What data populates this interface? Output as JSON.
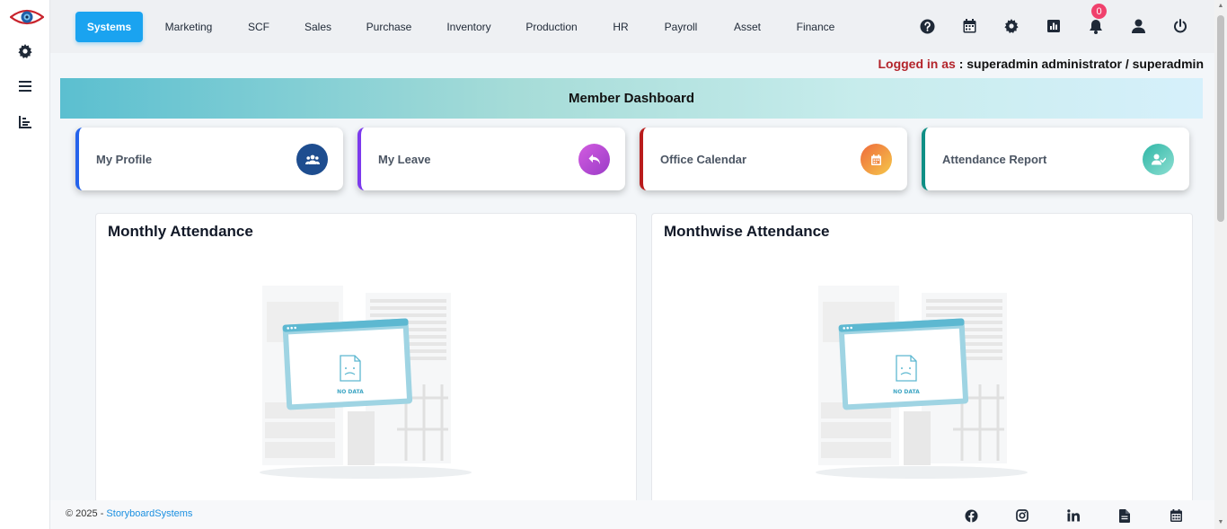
{
  "app": {
    "logo": "eye-logo"
  },
  "sidebar": {
    "items": [
      {
        "icon": "gear-icon"
      },
      {
        "icon": "menu-icon"
      },
      {
        "icon": "bar-chart-icon"
      }
    ]
  },
  "nav": {
    "items": [
      {
        "label": "Systems",
        "active": true
      },
      {
        "label": "Marketing"
      },
      {
        "label": "SCF"
      },
      {
        "label": "Sales"
      },
      {
        "label": "Purchase"
      },
      {
        "label": "Inventory"
      },
      {
        "label": "Production"
      },
      {
        "label": "HR"
      },
      {
        "label": "Payroll"
      },
      {
        "label": "Asset"
      },
      {
        "label": "Finance"
      }
    ],
    "icons": [
      "help-icon",
      "calendar-icon",
      "settings-icon",
      "report-icon",
      "bell-icon",
      "user-icon",
      "power-icon"
    ],
    "notification_count": "0"
  },
  "session": {
    "label": "Logged in as",
    "separator": " : ",
    "user": "superadmin administrator / superadmin"
  },
  "dashboard": {
    "title": "Member Dashboard",
    "cards": [
      {
        "label": "My Profile",
        "accent": "#2563eb",
        "icon": "users-icon"
      },
      {
        "label": "My Leave",
        "accent": "#7c3aed",
        "icon": "reply-icon"
      },
      {
        "label": "Office Calendar",
        "accent": "#b91c1c",
        "icon": "calendar-icon"
      },
      {
        "label": "Attendance Report",
        "accent": "#0f8f85",
        "icon": "user-check-icon"
      }
    ],
    "panels": [
      {
        "title": "Monthly Attendance",
        "empty_text": "NO DATA"
      },
      {
        "title": "Monthwise Attendance",
        "empty_text": "NO DATA"
      }
    ]
  },
  "footer": {
    "copyright": "© 2025 - ",
    "company": "StoryboardSystems",
    "icons": [
      "facebook-icon",
      "instagram-icon",
      "linkedin-icon",
      "document-icon",
      "calendar-icon"
    ]
  },
  "colors": {
    "accent": "#1aa3f0",
    "login_label": "#b3242b"
  }
}
